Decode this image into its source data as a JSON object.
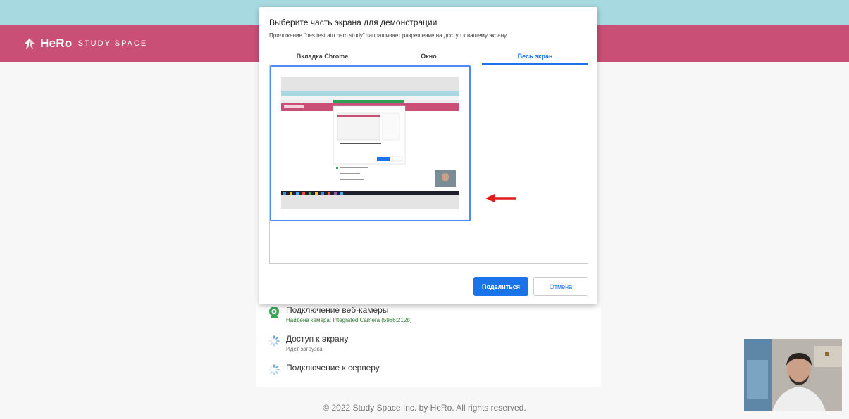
{
  "brand": {
    "name": "HeRo",
    "tagline": "STUDY SPACE"
  },
  "dialog": {
    "title": "Выберите часть экрана для демонстрации",
    "subtitle": "Приложение \"oes.test.atu.hero.study\" запрашивает разрешение на доступ к вашему экрану.",
    "tabs": [
      {
        "label": "Вкладка Chrome",
        "active": false
      },
      {
        "label": "Окно",
        "active": false
      },
      {
        "label": "Весь экран",
        "active": true
      }
    ],
    "share_label": "Поделиться",
    "cancel_label": "Отмена"
  },
  "checks": [
    {
      "title": "Подключение веб-камеры",
      "subtitle": "Найдена камера: Integrated Camera (5986:212b)",
      "status": "done"
    },
    {
      "title": "Доступ к экрану",
      "subtitle": "Идет загрузка",
      "status": "loading"
    },
    {
      "title": "Подключение к серверу",
      "subtitle": "",
      "status": "loading"
    }
  ],
  "footer": "© 2022 Study Space Inc. by HeRo. All rights reserved.",
  "colors": {
    "top_strip": "#a7d9e1",
    "brand_bar": "#c94f77",
    "accent_blue": "#1a73e8",
    "success_green": "#2e7d32",
    "arrow_red": "#e21b1b"
  },
  "icons": [
    "hero-logo-icon",
    "webcam-check-icon",
    "loading-spinner-icon",
    "red-arrow-icon"
  ]
}
